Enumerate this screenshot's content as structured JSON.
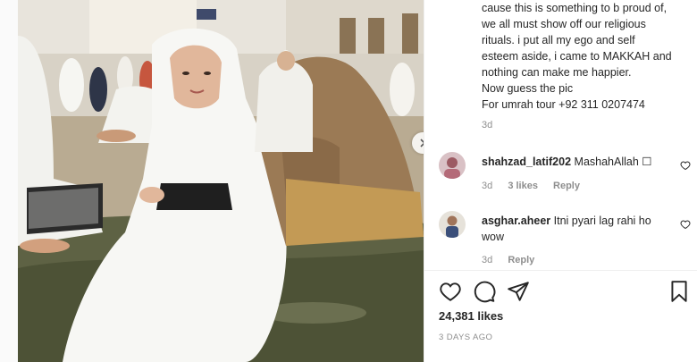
{
  "post": {
    "caption": "cause this is something to b proud of,\nwe all must show off our religious\nrituals. i put all my ego and self\nesteem aside, i came to MAKKAH and\nnothing can make me happier.\nNow guess the pic\nFor umrah tour +92 311 0207474",
    "caption_time": "3d",
    "likes": "24,381 likes",
    "date": "3 DAYS AGO"
  },
  "comments": [
    {
      "username": "shahzad_latif202",
      "text": "MashahAllah ☐",
      "time": "3d",
      "likes": "3 likes",
      "reply": "Reply"
    },
    {
      "username": "asghar.aheer",
      "text": "Itni pyari lag rahi ho wow",
      "time": "3d",
      "reply": "Reply"
    }
  ],
  "icons": [
    "chevron-right-icon",
    "heart-icon",
    "comment-icon",
    "share-icon",
    "bookmark-icon"
  ],
  "colors": {
    "text": "#262626",
    "muted": "#8e8e8e",
    "border": "#efefef"
  }
}
